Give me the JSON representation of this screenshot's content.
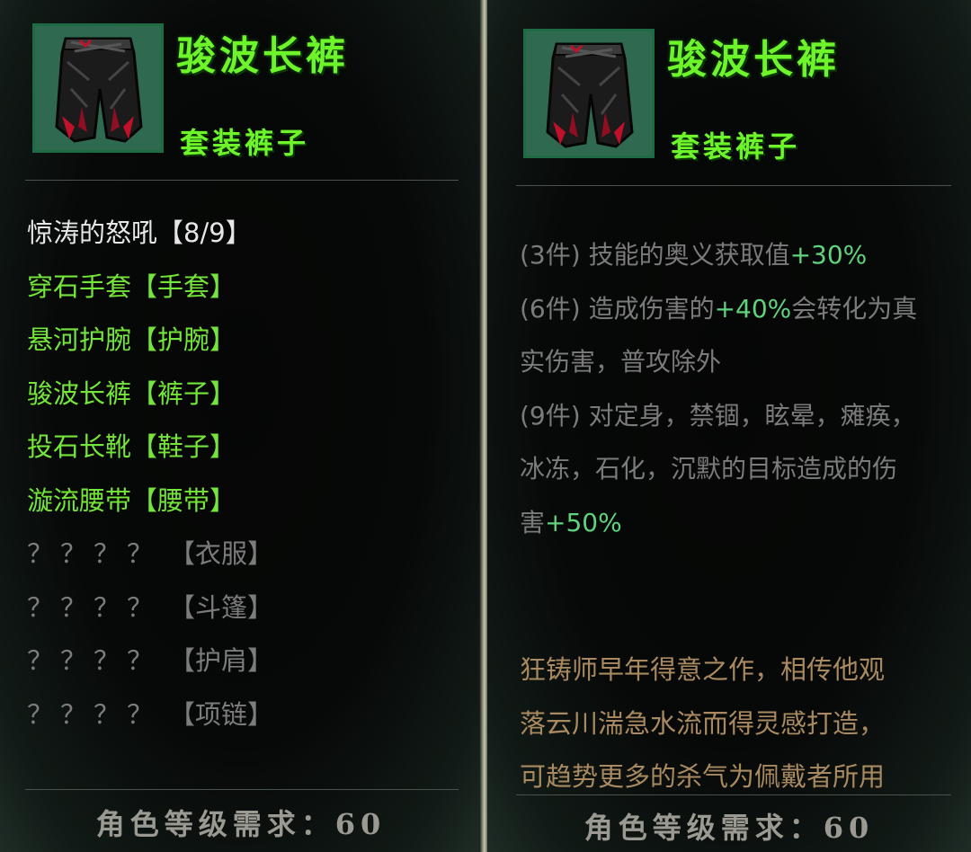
{
  "item": {
    "name": "骏波长裤",
    "type": "套装裤子",
    "icon": "pants-icon"
  },
  "set_panel": {
    "set_title": "惊涛的怒吼【8/9】",
    "pieces": [
      {
        "name": "穿石手套",
        "slot": "【手套】",
        "owned": true
      },
      {
        "name": "悬河护腕",
        "slot": "【护腕】",
        "owned": true
      },
      {
        "name": "骏波长裤",
        "slot": "【裤子】",
        "owned": true
      },
      {
        "name": "投石长靴",
        "slot": "【鞋子】",
        "owned": true
      },
      {
        "name": "漩流腰带",
        "slot": "【腰带】",
        "owned": true
      },
      {
        "name": "？？？？",
        "slot": "【衣服】",
        "owned": false
      },
      {
        "name": "？？？？",
        "slot": "【斗篷】",
        "owned": false
      },
      {
        "name": "？？？？",
        "slot": "【护肩】",
        "owned": false
      },
      {
        "name": "？？？？",
        "slot": "【项链】",
        "owned": false
      }
    ]
  },
  "bonus_panel": {
    "lines": [
      {
        "text": "(3件) 技能的奥义获取值",
        "value": "+30%",
        "after": ""
      },
      {
        "text": "(6件) 造成伤害的",
        "value": "+40%",
        "after": "会转化为真"
      },
      {
        "text": "实伤害，普攻除外",
        "value": "",
        "after": ""
      },
      {
        "text": "(9件) 对定身，禁锢，眩晕，瘫痪，",
        "value": "",
        "after": ""
      },
      {
        "text": "冰冻，石化，沉默的目标造成的伤",
        "value": "",
        "after": ""
      },
      {
        "text": "害",
        "value": "+50%",
        "after": ""
      }
    ],
    "lore": [
      "狂铸师早年得意之作，相传他观",
      "落云川湍急水流而得灵感打造，",
      "可趋势更多的杀气为佩戴者所用"
    ]
  },
  "requirement": "角色等级需求：60",
  "colors": {
    "item_green": "#6ef42a",
    "owned_green": "#74e53a",
    "bonus_value": "#5fd27e",
    "lore": "#a98a60",
    "missing": "#7c7c7c"
  }
}
